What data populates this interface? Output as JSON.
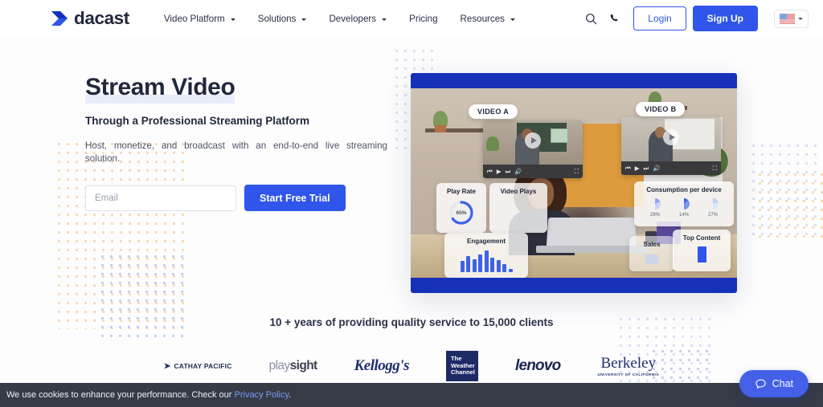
{
  "header": {
    "logo_text": "dacast",
    "logo_icon": "dacast-arrow-logo",
    "nav": [
      {
        "label": "Video Platform",
        "has_caret": true
      },
      {
        "label": "Solutions",
        "has_caret": true
      },
      {
        "label": "Developers",
        "has_caret": true
      },
      {
        "label": "Pricing",
        "has_caret": false
      },
      {
        "label": "Resources",
        "has_caret": true
      }
    ],
    "search_icon": "search-icon",
    "phone_icon": "phone-icon",
    "login_label": "Login",
    "signup_label": "Sign Up",
    "language_flag": "us-flag-icon"
  },
  "hero": {
    "title": "Stream Video",
    "subtitle": "Through a Professional Streaming Platform",
    "description": "Host, monetize, and broadcast with an end-to-end live streaming solution.",
    "email_placeholder": "Email",
    "email_value": "",
    "cta_label": "Start Free Trial"
  },
  "hero_image": {
    "video_a_label": "VIDEO A",
    "video_b_label": "VIDEO B",
    "widgets": {
      "play_rate_title": "Play Rate",
      "play_rate_value": "65%",
      "video_plays_title": "Video Plays",
      "engagement_title": "Engagement",
      "engagement_bars": [
        14,
        20,
        16,
        22,
        27,
        18,
        15,
        10,
        4
      ],
      "consumption_title": "Consumption per device",
      "consumption_values": [
        "28%",
        "14%",
        "27%"
      ],
      "top_content_title": "Top Content",
      "sales_title": "Sales"
    },
    "player_controls": {
      "prev": "⏮",
      "play": "▶",
      "next": "⏭",
      "volume": "ὐA",
      "fullscreen": "⛶"
    }
  },
  "clients": {
    "headline": "10 + years of providing quality service to 15,000 clients",
    "logos": [
      {
        "name": "Cathay Pacific",
        "text": "CATHAY PACIFIC"
      },
      {
        "name": "PlaySight",
        "text_light": "play",
        "text_bold": "sight"
      },
      {
        "name": "Kellogg's",
        "text": "Kellogg's"
      },
      {
        "name": "The Weather Channel",
        "line1": "The",
        "line2": "Weather",
        "line3": "Channel"
      },
      {
        "name": "Lenovo",
        "text": "lenovo"
      },
      {
        "name": "Berkeley",
        "text": "Berkeley",
        "sub": "UNIVERSITY OF CALIFORNIA"
      }
    ]
  },
  "cookie": {
    "message": "We use cookies to enhance your performance. Check our ",
    "link_label": "Privacy Policy",
    "suffix": "."
  },
  "chat": {
    "label": "Chat",
    "icon": "chat-bubble-icon"
  },
  "colors": {
    "brand_blue": "#2f55ea",
    "deep_blue": "#1730b8",
    "dark_navy": "#22283c",
    "cookie_bg": "#353b47",
    "chat_blue": "#4460e8"
  }
}
